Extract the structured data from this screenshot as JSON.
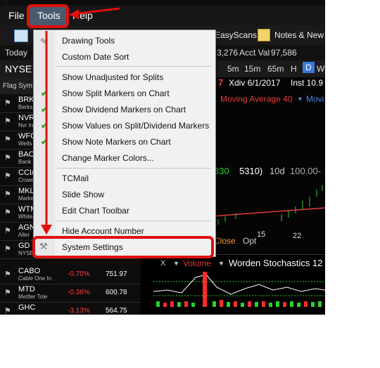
{
  "menubar": {
    "file": "File",
    "tools": "Tools",
    "help": "Help"
  },
  "toolbar": {
    "easyscans": "EasyScans",
    "notes": "Notes & New"
  },
  "account": {
    "today": "Today",
    "value1": "3,276",
    "acct_label": "Acct Val",
    "acct_value": "97,586"
  },
  "exchange": {
    "label": "NYSE",
    "timeframes": [
      "5m",
      "15m",
      "65m",
      "H",
      "D",
      "W"
    ]
  },
  "chart_header": {
    "red_num": "7",
    "xdiv": "Xdiv 6/1/2017",
    "inst": "Inst 10.9"
  },
  "indicator": {
    "ma": "Moving Average 40",
    "movi": "Movi"
  },
  "quote": {
    "v1": "330",
    "v2": "5310)",
    "v3": "10d",
    "v4": "100.00-"
  },
  "xaxis": {
    "d22": "22",
    "d15": "15"
  },
  "chart_bottom": {
    "close": "Close",
    "opt": "Opt"
  },
  "lower_pane": {
    "x": "X",
    "volume": "Volume",
    "stoch": "Worden Stochastics 12"
  },
  "watchlist": {
    "headers": {
      "flag": "Flag",
      "sym": "Sym"
    },
    "rows": [
      {
        "sym": "BRK/",
        "name": "Berks",
        "change": "",
        "price": ""
      },
      {
        "sym": "NVR",
        "name": "Nvr In",
        "change": "",
        "price": ""
      },
      {
        "sym": "WFC",
        "name": "Wells",
        "change": "",
        "price": ""
      },
      {
        "sym": "BAC",
        "name": "Bank",
        "change": "",
        "price": ""
      },
      {
        "sym": "CCI/",
        "name": "Crown",
        "change": "",
        "price": ""
      },
      {
        "sym": "MKL",
        "name": "Marke",
        "change": "",
        "price": ""
      },
      {
        "sym": "WTM",
        "name": "White",
        "change": "",
        "price": ""
      },
      {
        "sym": "AGN",
        "name": "Aller",
        "change": "",
        "price": ""
      },
      {
        "sym": "GD",
        "name": "NYSE Arca G",
        "change": "",
        "price": ""
      },
      {
        "sym": "CABO",
        "name": "Cable One In",
        "change": "-0.70%",
        "price": "751.97"
      },
      {
        "sym": "MTD",
        "name": "Mettler Tole",
        "change": "-0.36%",
        "price": "600.78"
      },
      {
        "sym": "GHC",
        "name": "",
        "change": "-3.13%",
        "price": "564.75"
      }
    ]
  },
  "tools_menu": {
    "drawing_tools": "Drawing Tools",
    "custom_date_sort": "Custom Date Sort",
    "show_unadjusted": "Show Unadjusted for Splits",
    "show_split_markers": "Show Split Markers on Chart",
    "show_dividend_markers": "Show Dividend Markers on Chart",
    "show_values": "Show Values on Split/Dividend Markers",
    "show_note_markers": "Show Note Markers on Chart",
    "change_marker_colors": "Change Marker Colors...",
    "tcmail": "TCMail",
    "slide_show": "Slide Show",
    "edit_chart_toolbar": "Edit Chart Toolbar",
    "hide_account_number": "Hide Account Number",
    "system_settings": "System Settings",
    "checked_items": [
      "show_split_markers",
      "show_dividend_markers",
      "show_values",
      "show_note_markers"
    ]
  },
  "colors": {
    "annotation_red": "#e01010",
    "check_green": "#2aa52a",
    "menu_bg": "#f1f1f1"
  }
}
